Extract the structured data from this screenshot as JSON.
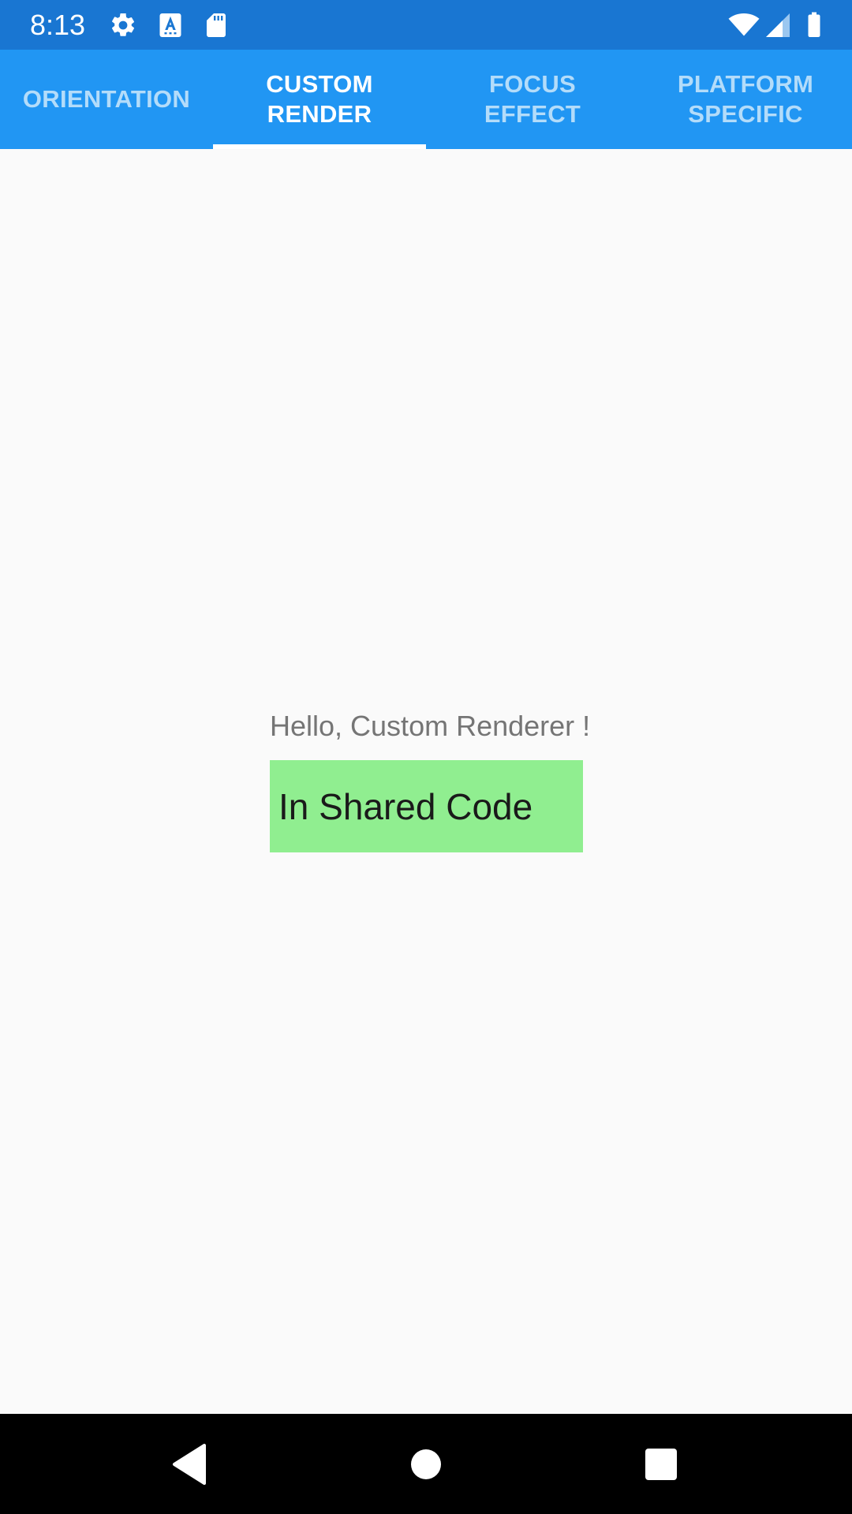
{
  "status_bar": {
    "time": "8:13",
    "left_icons": [
      "settings-icon",
      "accessibility-a-icon",
      "sd-card-icon"
    ],
    "right_icons": [
      "wifi-icon",
      "cell-signal-icon",
      "battery-icon"
    ],
    "background_color": "#1976D2"
  },
  "tabs": {
    "items": [
      {
        "label": "ORIENTATION",
        "active": false
      },
      {
        "label": "CUSTOM\nRENDER",
        "active": true
      },
      {
        "label": "FOCUS\nEFFECT",
        "active": false
      },
      {
        "label": "PLATFORM\nSPECIFIC",
        "active": false
      }
    ],
    "background_color": "#2196F3",
    "active_text_color": "#FFFFFF",
    "inactive_text_color": "#B3DCFA"
  },
  "content": {
    "hello_text": "Hello, Custom Renderer !",
    "shared_code_text": "In Shared Code",
    "shared_code_background": "#90EE90"
  },
  "nav_bar": {
    "buttons": [
      "back-icon",
      "home-icon",
      "recents-icon"
    ]
  }
}
